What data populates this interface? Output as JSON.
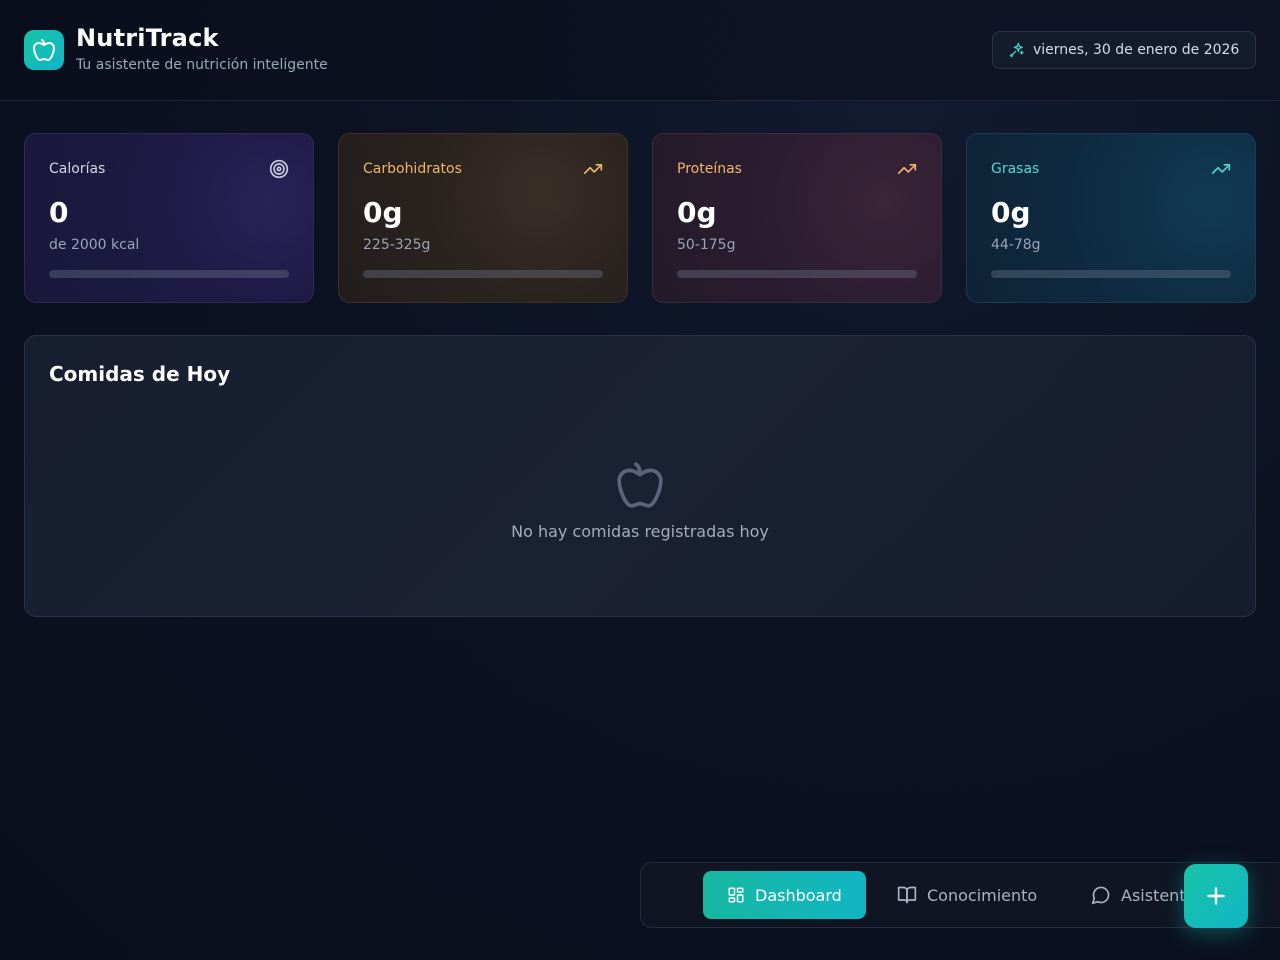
{
  "header": {
    "title": "NutriTrack",
    "subtitle": "Tu asistente de nutrición inteligente",
    "date": "viernes, 30 de enero de 2026",
    "date_icon": "sparkles-icon",
    "logo_icon": "apple-icon"
  },
  "stats": [
    {
      "label": "Calorías",
      "value": "0",
      "target": "de 2000 kcal",
      "icon": "target-icon",
      "progress": 0,
      "color": "#d4d7e6"
    },
    {
      "label": "Carbohidratos",
      "value": "0g",
      "target": "225-325g",
      "icon": "trending-up-icon",
      "progress": 0,
      "color": "#f1b46a"
    },
    {
      "label": "Proteínas",
      "value": "0g",
      "target": "50-175g",
      "icon": "trending-up-icon",
      "progress": 0,
      "color": "#f1b46a"
    },
    {
      "label": "Grasas",
      "value": "0g",
      "target": "44-78g",
      "icon": "trending-up-icon",
      "progress": 0,
      "color": "#4fd8d0"
    }
  ],
  "meals": {
    "title": "Comidas de Hoy",
    "empty_text": "No hay comidas registradas hoy",
    "empty_icon": "apple-icon"
  },
  "nav": {
    "items": [
      {
        "label": "Dashboard",
        "icon": "dashboard-icon",
        "active": true
      },
      {
        "label": "Conocimiento",
        "icon": "book-icon",
        "active": false
      },
      {
        "label": "Asistente",
        "icon": "chat-icon",
        "active": false
      }
    ]
  },
  "fab": {
    "icon": "plus-icon"
  },
  "colors": {
    "accent": "#16b8a0",
    "accent2": "#0fb5c6",
    "background": "#0c1222"
  }
}
